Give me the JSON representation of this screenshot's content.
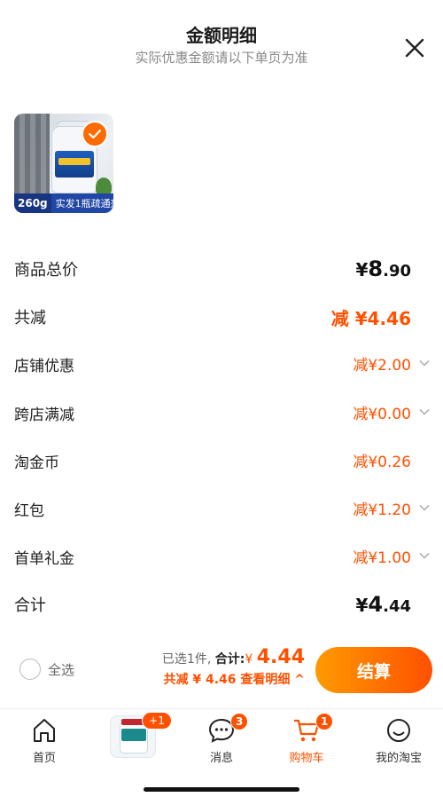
{
  "header": {
    "title": "金额明细",
    "subtitle": "实际优惠金额请以下单页为准"
  },
  "product": {
    "badge_weight": "260g",
    "badge_text": "实发1瓶疏通剂"
  },
  "rows": {
    "goods_total": {
      "label": "商品总价",
      "currency": "¥",
      "int": "8",
      "dec": ".90"
    },
    "total_reduce": {
      "label": "共减",
      "prefix": "减",
      "currency": "¥",
      "amount": "4.46"
    },
    "store_discount": {
      "label": "店铺优惠",
      "value": "减¥2.00"
    },
    "cross_store": {
      "label": "跨店满减",
      "value": "减¥0.00"
    },
    "taojinbi": {
      "label": "淘金币",
      "value": "减¥0.26"
    },
    "red_packet": {
      "label": "红包",
      "value": "减¥1.20"
    },
    "first_order": {
      "label": "首单礼金",
      "value": "减¥1.00"
    },
    "total": {
      "label": "合计",
      "currency": "¥",
      "int": "4",
      "dec": ".44"
    }
  },
  "footer": {
    "select_all": "全选",
    "selected": "已选1件,",
    "sum_label": "合计:",
    "sum_currency": "¥",
    "sum_value": "4.44",
    "detail_link": "共减 ¥ 4.46  查看明细 ^",
    "checkout": "结算"
  },
  "tabbar": {
    "home": "首页",
    "messages": "消息",
    "messages_badge": "3",
    "cart": "购物车",
    "cart_badge": "1",
    "promo_badge": "+1",
    "me": "我的淘宝"
  },
  "colors": {
    "accent": "#ff5000",
    "accent_light": "#ff9a00"
  }
}
